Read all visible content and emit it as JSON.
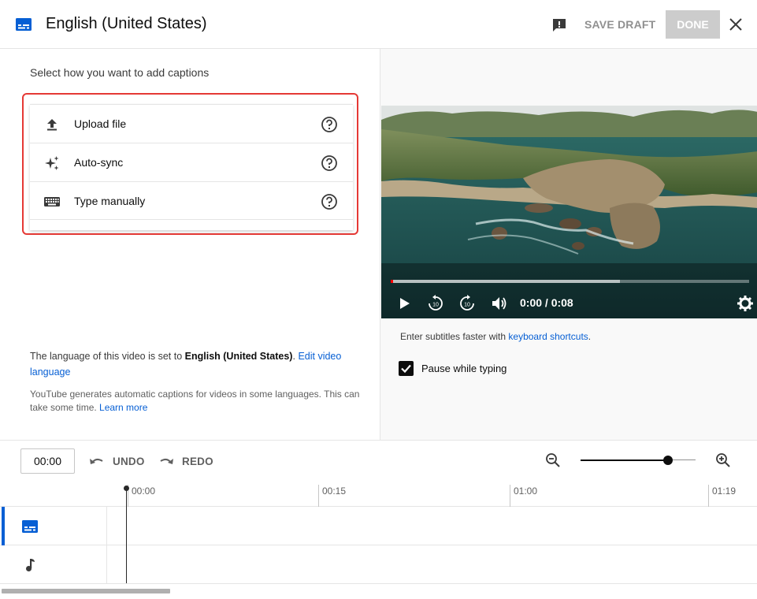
{
  "header": {
    "title": "English (United States)",
    "save_draft_label": "SAVE DRAFT",
    "done_label": "DONE"
  },
  "left_panel": {
    "prompt": "Select how you want to add captions",
    "options": [
      {
        "label": "Upload file",
        "icon": "upload-icon"
      },
      {
        "label": "Auto-sync",
        "icon": "sparkle-icon"
      },
      {
        "label": "Type manually",
        "icon": "keyboard-icon"
      }
    ],
    "language_note": {
      "prefix": "The language of this video is set to ",
      "language": "English (United States)",
      "suffix": ". ",
      "link": "Edit video language"
    },
    "auto_note": {
      "text": "YouTube generates automatic captions for videos in some languages. This can take some time. ",
      "link": "Learn more"
    }
  },
  "player": {
    "time": "0:00 / 0:08",
    "progress_buffered": 0.64,
    "progress_played": 0.0
  },
  "right_panel": {
    "shortcut_prefix": "Enter subtitles faster with ",
    "shortcut_link": "keyboard shortcuts",
    "shortcut_suffix": ".",
    "pause_while_typing_label": "Pause while typing",
    "pause_while_typing_checked": true
  },
  "timeline": {
    "current_time": "00:00",
    "undo_label": "UNDO",
    "redo_label": "REDO",
    "ruler_ticks": [
      "00:00",
      "00:15",
      "01:00",
      "01:19"
    ],
    "zoom_level": 0.76
  },
  "colors": {
    "accent": "#065fd4",
    "highlight": "#e53935",
    "done_disabled": "#cccccc"
  }
}
